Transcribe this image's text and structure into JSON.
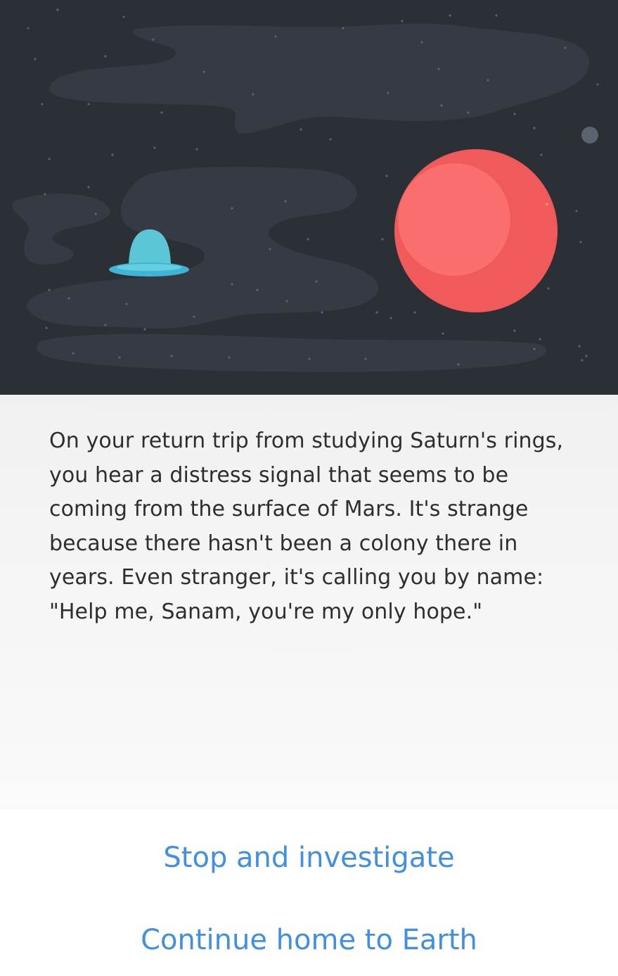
{
  "story": {
    "lines": [
      "On your return trip from studying Saturn's rings,",
      "you hear a distress signal that seems to be",
      "coming from the surface of Mars. It's strange",
      "because there hasn't been a colony there in",
      "years. Even stranger, it's calling you by name:",
      "\"Help me, Sanam, you're my only hope.\""
    ]
  },
  "choices": {
    "investigate": "Stop and investigate",
    "continue_home": "Continue home to Earth"
  },
  "colors": {
    "sky": "#2b2f36",
    "nebula": "#383d46",
    "planet": "#f15a5a",
    "planet_highlight": "#fa6e6e",
    "ufo_dome": "#5bc7d6",
    "ufo_disc": "#3fb4d4",
    "choice_text": "#3f8fe4"
  },
  "icons": {
    "ufo": "ufo-icon",
    "planet": "mars-planet-icon",
    "moon": "small-moon-icon"
  }
}
